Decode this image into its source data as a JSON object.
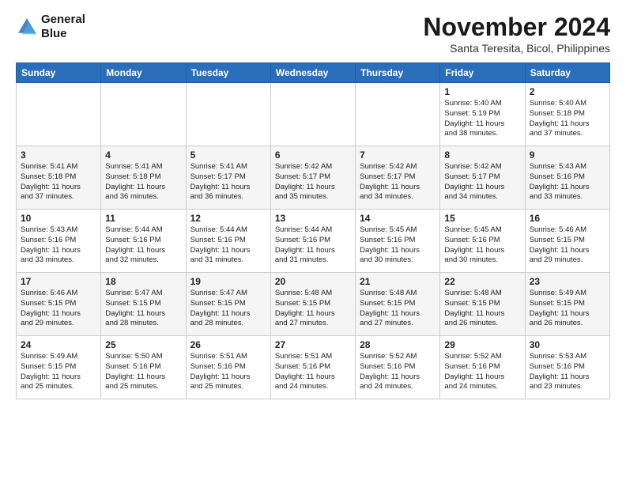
{
  "header": {
    "logo_line1": "General",
    "logo_line2": "Blue",
    "month": "November 2024",
    "location": "Santa Teresita, Bicol, Philippines"
  },
  "weekdays": [
    "Sunday",
    "Monday",
    "Tuesday",
    "Wednesday",
    "Thursday",
    "Friday",
    "Saturday"
  ],
  "weeks": [
    [
      {
        "day": "",
        "info": ""
      },
      {
        "day": "",
        "info": ""
      },
      {
        "day": "",
        "info": ""
      },
      {
        "day": "",
        "info": ""
      },
      {
        "day": "",
        "info": ""
      },
      {
        "day": "1",
        "info": "Sunrise: 5:40 AM\nSunset: 5:19 PM\nDaylight: 11 hours\nand 38 minutes."
      },
      {
        "day": "2",
        "info": "Sunrise: 5:40 AM\nSunset: 5:18 PM\nDaylight: 11 hours\nand 37 minutes."
      }
    ],
    [
      {
        "day": "3",
        "info": "Sunrise: 5:41 AM\nSunset: 5:18 PM\nDaylight: 11 hours\nand 37 minutes."
      },
      {
        "day": "4",
        "info": "Sunrise: 5:41 AM\nSunset: 5:18 PM\nDaylight: 11 hours\nand 36 minutes."
      },
      {
        "day": "5",
        "info": "Sunrise: 5:41 AM\nSunset: 5:17 PM\nDaylight: 11 hours\nand 36 minutes."
      },
      {
        "day": "6",
        "info": "Sunrise: 5:42 AM\nSunset: 5:17 PM\nDaylight: 11 hours\nand 35 minutes."
      },
      {
        "day": "7",
        "info": "Sunrise: 5:42 AM\nSunset: 5:17 PM\nDaylight: 11 hours\nand 34 minutes."
      },
      {
        "day": "8",
        "info": "Sunrise: 5:42 AM\nSunset: 5:17 PM\nDaylight: 11 hours\nand 34 minutes."
      },
      {
        "day": "9",
        "info": "Sunrise: 5:43 AM\nSunset: 5:16 PM\nDaylight: 11 hours\nand 33 minutes."
      }
    ],
    [
      {
        "day": "10",
        "info": "Sunrise: 5:43 AM\nSunset: 5:16 PM\nDaylight: 11 hours\nand 33 minutes."
      },
      {
        "day": "11",
        "info": "Sunrise: 5:44 AM\nSunset: 5:16 PM\nDaylight: 11 hours\nand 32 minutes."
      },
      {
        "day": "12",
        "info": "Sunrise: 5:44 AM\nSunset: 5:16 PM\nDaylight: 11 hours\nand 31 minutes."
      },
      {
        "day": "13",
        "info": "Sunrise: 5:44 AM\nSunset: 5:16 PM\nDaylight: 11 hours\nand 31 minutes."
      },
      {
        "day": "14",
        "info": "Sunrise: 5:45 AM\nSunset: 5:16 PM\nDaylight: 11 hours\nand 30 minutes."
      },
      {
        "day": "15",
        "info": "Sunrise: 5:45 AM\nSunset: 5:16 PM\nDaylight: 11 hours\nand 30 minutes."
      },
      {
        "day": "16",
        "info": "Sunrise: 5:46 AM\nSunset: 5:15 PM\nDaylight: 11 hours\nand 29 minutes."
      }
    ],
    [
      {
        "day": "17",
        "info": "Sunrise: 5:46 AM\nSunset: 5:15 PM\nDaylight: 11 hours\nand 29 minutes."
      },
      {
        "day": "18",
        "info": "Sunrise: 5:47 AM\nSunset: 5:15 PM\nDaylight: 11 hours\nand 28 minutes."
      },
      {
        "day": "19",
        "info": "Sunrise: 5:47 AM\nSunset: 5:15 PM\nDaylight: 11 hours\nand 28 minutes."
      },
      {
        "day": "20",
        "info": "Sunrise: 5:48 AM\nSunset: 5:15 PM\nDaylight: 11 hours\nand 27 minutes."
      },
      {
        "day": "21",
        "info": "Sunrise: 5:48 AM\nSunset: 5:15 PM\nDaylight: 11 hours\nand 27 minutes."
      },
      {
        "day": "22",
        "info": "Sunrise: 5:48 AM\nSunset: 5:15 PM\nDaylight: 11 hours\nand 26 minutes."
      },
      {
        "day": "23",
        "info": "Sunrise: 5:49 AM\nSunset: 5:15 PM\nDaylight: 11 hours\nand 26 minutes."
      }
    ],
    [
      {
        "day": "24",
        "info": "Sunrise: 5:49 AM\nSunset: 5:15 PM\nDaylight: 11 hours\nand 25 minutes."
      },
      {
        "day": "25",
        "info": "Sunrise: 5:50 AM\nSunset: 5:16 PM\nDaylight: 11 hours\nand 25 minutes."
      },
      {
        "day": "26",
        "info": "Sunrise: 5:51 AM\nSunset: 5:16 PM\nDaylight: 11 hours\nand 25 minutes."
      },
      {
        "day": "27",
        "info": "Sunrise: 5:51 AM\nSunset: 5:16 PM\nDaylight: 11 hours\nand 24 minutes."
      },
      {
        "day": "28",
        "info": "Sunrise: 5:52 AM\nSunset: 5:16 PM\nDaylight: 11 hours\nand 24 minutes."
      },
      {
        "day": "29",
        "info": "Sunrise: 5:52 AM\nSunset: 5:16 PM\nDaylight: 11 hours\nand 24 minutes."
      },
      {
        "day": "30",
        "info": "Sunrise: 5:53 AM\nSunset: 5:16 PM\nDaylight: 11 hours\nand 23 minutes."
      }
    ]
  ]
}
